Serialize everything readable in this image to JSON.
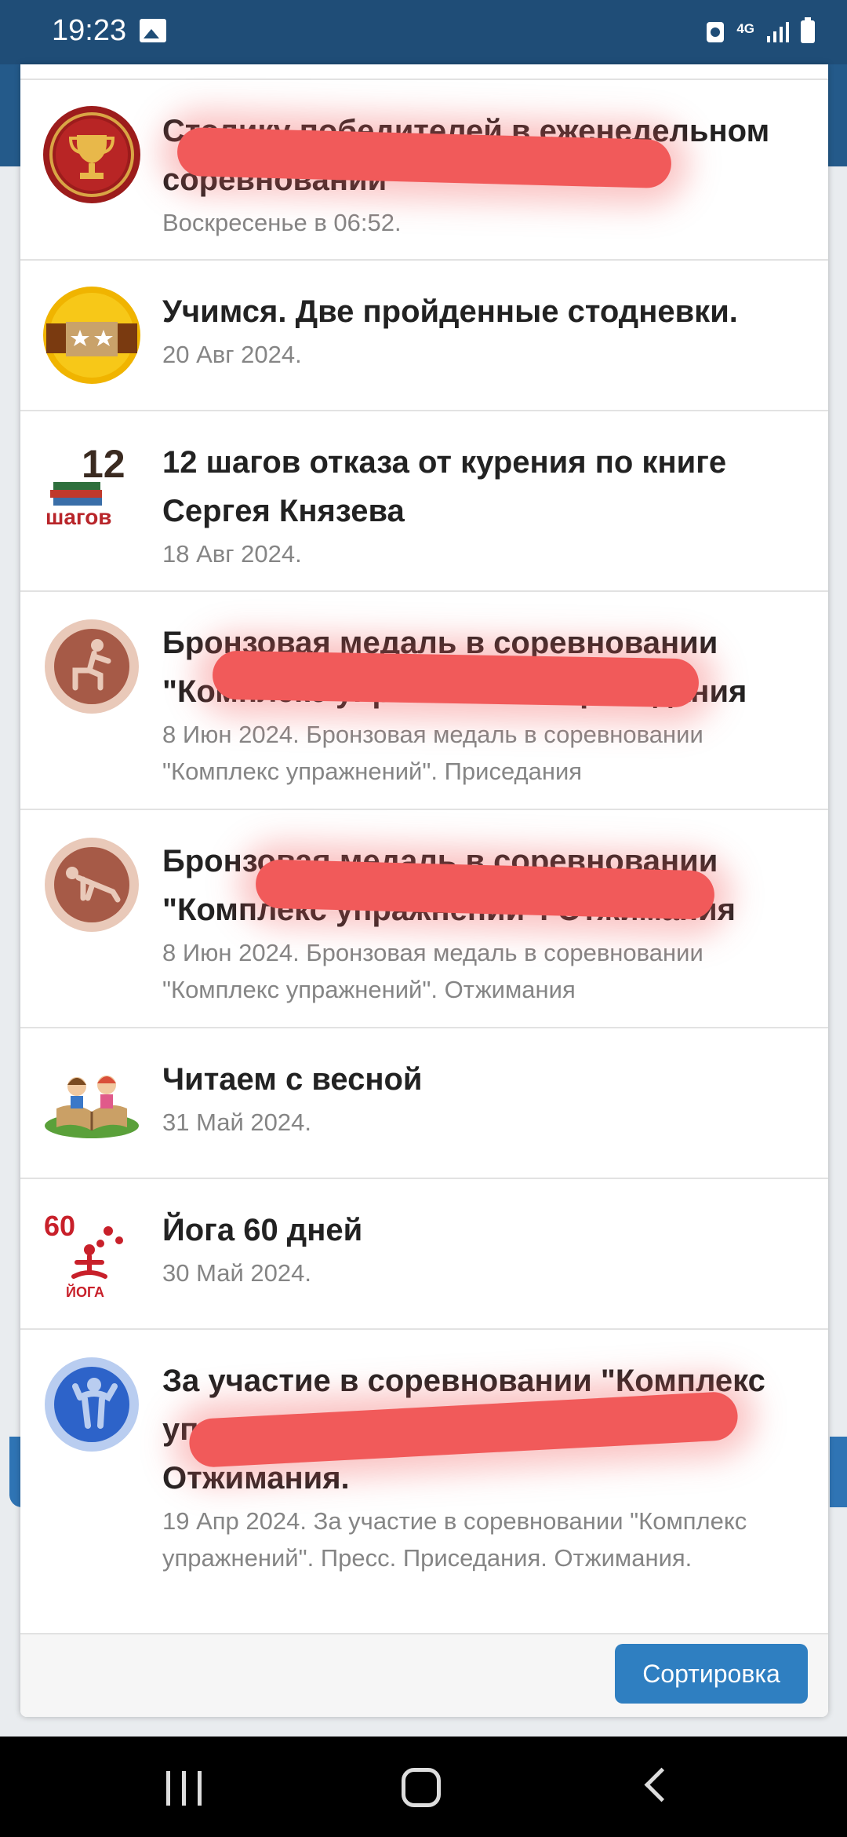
{
  "status_bar": {
    "time": "19:23",
    "network": "4G"
  },
  "list": {
    "items": [
      {
        "title": "Столику победителей в еженедельном соревновании",
        "date": "Воскресенье в 06:52.",
        "icon": "trophy-icon"
      },
      {
        "title": "Учимся. Две пройденные стодневки.",
        "date": "20 Авг 2024.",
        "icon": "two-stars-badge-icon"
      },
      {
        "title": "12 шагов отказа от курения по книге Сергея Князева",
        "date": "18 Авг 2024.",
        "icon": "12-steps-books-icon"
      },
      {
        "title": "Бронзовая медаль в соревновании \"Комплекс упражнений\". Приседания",
        "date": "8 Июн 2024. Бронзовая медаль в соревновании \"Комплекс упражнений\". Приседания",
        "icon": "bronze-medal-squat-icon"
      },
      {
        "title": "Бронзовая медаль в соревновании \"Комплекс упражнений\". Отжимания",
        "date": "8 Июн 2024. Бронзовая медаль в соревновании \"Комплекс упражнений\". Отжимания",
        "icon": "bronze-medal-pushup-icon"
      },
      {
        "title": "Читаем с весной",
        "date": "31 Май 2024.",
        "icon": "kids-reading-book-icon"
      },
      {
        "title": "Йога 60 дней",
        "date": "30 Май 2024.",
        "icon": "yoga-60-icon"
      },
      {
        "title": "За участие в соревновании \"Комплекс упражнений\". Пресс. Приседания. Отжимания.",
        "date": "19 Апр 2024. За участие в соревновании \"Комплекс упражнений\". Пресс. Приседания. Отжимания.",
        "icon": "blue-athlete-medal-icon"
      }
    ]
  },
  "footer": {
    "sort_label": "Сортировка"
  },
  "colors": {
    "accent": "#2f7fc1",
    "header": "#1f4d77",
    "redaction": "#f15a5a",
    "bronze": "#a65a47"
  }
}
